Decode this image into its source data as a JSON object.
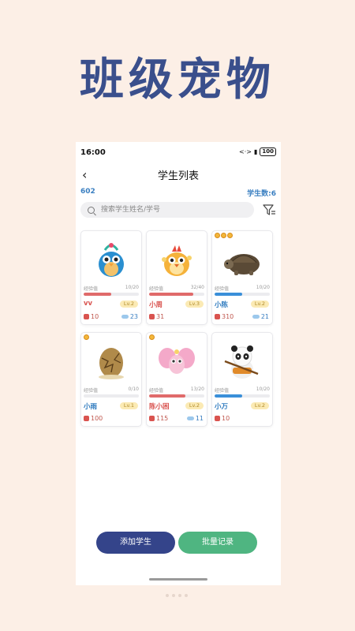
{
  "promo": {
    "title": "班级宠物"
  },
  "status": {
    "time": "16:00",
    "battery": "100"
  },
  "nav": {
    "title": "学生列表"
  },
  "info": {
    "class_code": "602",
    "student_count": "学生数:6"
  },
  "search": {
    "placeholder": "搜索学生姓名/学号"
  },
  "students": [
    {
      "name": "vv",
      "exp_label": "经验值",
      "exp": "10/20",
      "exp_ratio": 0.5,
      "bar_color": "#e06a6a",
      "name_color": "#d9534f",
      "level": "Lv.2",
      "coins": "10",
      "fish": "23",
      "medals": 0,
      "pet": "peacock-chick"
    },
    {
      "name": "小周",
      "exp_label": "经验值",
      "exp": "32/40",
      "exp_ratio": 0.8,
      "bar_color": "#e06a6a",
      "name_color": "#d9534f",
      "level": "Lv.3",
      "coins": "31",
      "fish": "",
      "medals": 0,
      "pet": "golden-chick"
    },
    {
      "name": "小陈",
      "exp_label": "经验值",
      "exp": "10/20",
      "exp_ratio": 0.5,
      "bar_color": "#3a8fd9",
      "name_color": "#2f7bbf",
      "level": "Lv.2",
      "coins": "310",
      "fish": "21",
      "medals": 3,
      "pet": "tortoise"
    },
    {
      "name": "小雨",
      "exp_label": "经验值",
      "exp": "0/10",
      "exp_ratio": 0.0,
      "bar_color": "#3a8fd9",
      "name_color": "#2f7bbf",
      "level": "Lv.1",
      "coins": "100",
      "fish": "",
      "medals": 1,
      "pet": "egg"
    },
    {
      "name": "陈小困",
      "exp_label": "经验值",
      "exp": "13/20",
      "exp_ratio": 0.65,
      "bar_color": "#e06a6a",
      "name_color": "#d9534f",
      "level": "Lv.2",
      "coins": "115",
      "fish": "11",
      "medals": 1,
      "pet": "butterfly-fairy"
    },
    {
      "name": "小万",
      "exp_label": "经验值",
      "exp": "10/20",
      "exp_ratio": 0.5,
      "bar_color": "#3a8fd9",
      "name_color": "#2f7bbf",
      "level": "Lv.2",
      "coins": "10",
      "fish": "",
      "medals": 0,
      "pet": "panda"
    }
  ],
  "actions": {
    "add_label": "添加学生",
    "batch_label": "批量记录"
  }
}
